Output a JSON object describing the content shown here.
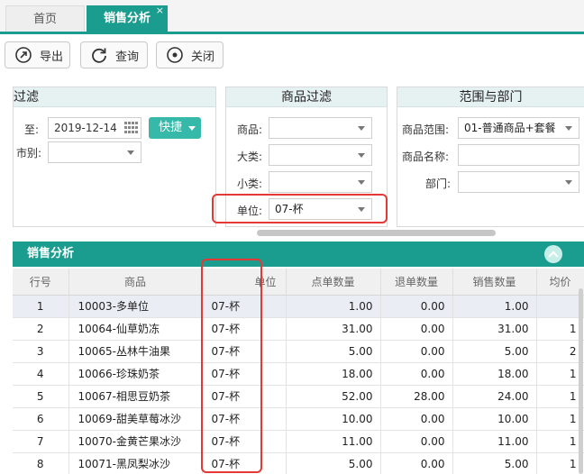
{
  "tabs": [
    {
      "label": "首页",
      "active": false
    },
    {
      "label": "销售分析",
      "active": true
    }
  ],
  "tab_close_glyph": "×",
  "toolbar": {
    "export_label": "导出",
    "query_label": "查询",
    "close_label": "关闭"
  },
  "time_filter": {
    "title": "过滤",
    "to_label": "至:",
    "to_value": "2019-12-14",
    "quick_label": "快捷",
    "city_label": "市别:",
    "city_value": ""
  },
  "goods_filter": {
    "title": "商品过滤",
    "goods_label": "商品:",
    "goods_value": "",
    "category_label": "大类:",
    "category_value": "",
    "subcategory_label": "小类:",
    "subcategory_value": "",
    "unit_label": "单位:",
    "unit_value": "07-杯"
  },
  "range_filter": {
    "title": "范围与部门",
    "range_label": "商品范围:",
    "range_value": "01-普通商品+套餐",
    "name_label": "商品名称:",
    "name_value": "",
    "dept_label": "部门:",
    "dept_value": ""
  },
  "grid": {
    "title": "销售分析",
    "columns": [
      "行号",
      "商品",
      "单位",
      "点单数量",
      "退单数量",
      "销售数量",
      "均价"
    ],
    "rows": [
      [
        "1",
        "10003-多单位",
        "07-杯",
        "1.00",
        "0.00",
        "1.00",
        ""
      ],
      [
        "2",
        "10064-仙草奶冻",
        "07-杯",
        "31.00",
        "0.00",
        "31.00",
        "1"
      ],
      [
        "3",
        "10065-丛林牛油果",
        "07-杯",
        "5.00",
        "0.00",
        "5.00",
        "2"
      ],
      [
        "4",
        "10066-珍珠奶茶",
        "07-杯",
        "18.00",
        "0.00",
        "18.00",
        "1"
      ],
      [
        "5",
        "10067-相思豆奶茶",
        "07-杯",
        "52.00",
        "28.00",
        "24.00",
        "1"
      ],
      [
        "6",
        "10069-甜美草莓冰沙",
        "07-杯",
        "10.00",
        "0.00",
        "10.00",
        "1"
      ],
      [
        "7",
        "10070-金黄芒果冰沙",
        "07-杯",
        "11.00",
        "0.00",
        "11.00",
        "1"
      ],
      [
        "8",
        "10071-黑凤梨冰沙",
        "07-杯",
        "5.00",
        "0.00",
        "5.00",
        "1"
      ]
    ]
  },
  "colors": {
    "accent": "#1a9d8f",
    "quick_button": "#36b9a9",
    "highlight_box": "#e53935"
  }
}
